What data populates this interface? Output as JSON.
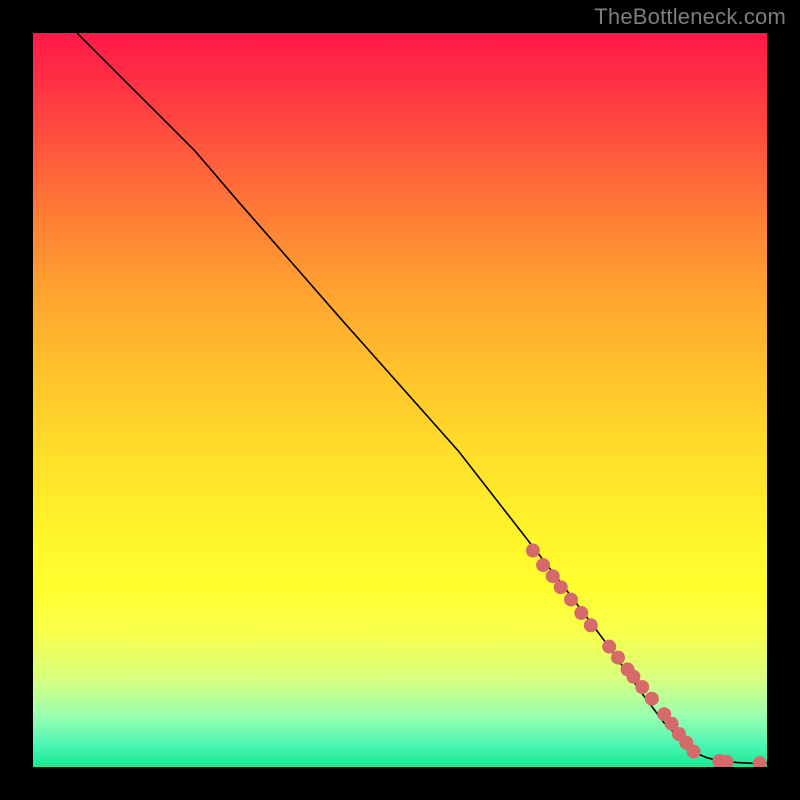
{
  "watermark": "TheBottleneck.com",
  "chart_data": {
    "type": "line",
    "title": "",
    "xlabel": "",
    "ylabel": "",
    "xlim": [
      0,
      100
    ],
    "ylim": [
      0,
      100
    ],
    "grid": false,
    "legend": false,
    "curve": {
      "name": "bottleneck-curve",
      "x": [
        6,
        8,
        10,
        13,
        17,
        22,
        28,
        35,
        42,
        50,
        58,
        65,
        72,
        78,
        83,
        86,
        88,
        90,
        92,
        94,
        96,
        98,
        100
      ],
      "y": [
        100,
        98,
        96,
        93,
        89,
        84,
        77,
        69,
        61,
        52,
        43,
        34,
        25,
        17,
        10,
        6,
        4,
        2,
        1.2,
        0.8,
        0.6,
        0.5,
        0.5
      ]
    },
    "points": {
      "name": "data-points",
      "color": "#d66a6a",
      "radius_px": 7,
      "x": [
        68.1,
        69.5,
        70.8,
        71.9,
        73.3,
        74.7,
        76.0,
        78.5,
        79.7,
        81.0,
        81.8,
        83.0,
        84.3,
        86.0,
        87.0,
        88.0,
        89.0,
        90.0,
        93.5,
        94.5,
        99.0
      ],
      "y": [
        29.5,
        27.5,
        26.0,
        24.5,
        22.8,
        21.0,
        19.3,
        16.4,
        14.9,
        13.3,
        12.3,
        10.9,
        9.3,
        7.2,
        5.9,
        4.5,
        3.3,
        2.1,
        0.8,
        0.7,
        0.5
      ]
    }
  }
}
